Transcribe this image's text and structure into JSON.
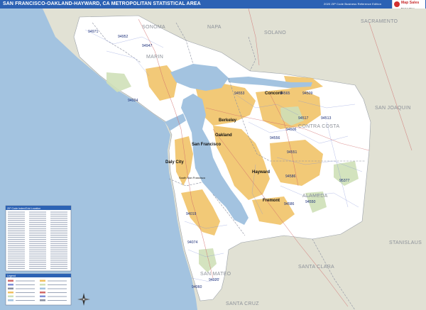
{
  "title": "SAN FRANCISCO-OAKLAND-HAYWARD, CA METROPOLITAN STATISTICAL AREA",
  "edition": "2020 ZIP Code Business Reference Edition",
  "logo": {
    "name": "Map Sales",
    "tagline": "Market Maps"
  },
  "colors": {
    "water": "#a3c3e0",
    "outside_land": "#e1e1d4",
    "metro_land": "#ffffff",
    "urban": "#f0c060",
    "park": "#cfe0b8",
    "title_bar": "#2c62b4",
    "zip_label": "#1b2f7a"
  },
  "counties": [
    {
      "id": "sonoma",
      "label": "SONOMA"
    },
    {
      "id": "napa",
      "label": "NAPA"
    },
    {
      "id": "solano",
      "label": "SOLANO"
    },
    {
      "id": "sacramento",
      "label": "SACRAMENTO"
    },
    {
      "id": "marin",
      "label": "MARIN"
    },
    {
      "id": "san-joaquin",
      "label": "SAN JOAQUIN"
    },
    {
      "id": "contra-costa",
      "label": "CONTRA COSTA"
    },
    {
      "id": "alameda",
      "label": "ALAMEDA"
    },
    {
      "id": "stanislaus",
      "label": "STANISLAUS"
    },
    {
      "id": "san-mateo",
      "label": "SAN MATEO"
    },
    {
      "id": "santa-clara",
      "label": "SANTA CLARA"
    },
    {
      "id": "santa-cruz",
      "label": "SANTA CRUZ"
    }
  ],
  "cities": [
    {
      "id": "concord",
      "label": "Concord"
    },
    {
      "id": "berkeley",
      "label": "Berkeley"
    },
    {
      "id": "oakland",
      "label": "Oakland"
    },
    {
      "id": "san-francisco",
      "label": "San Francisco"
    },
    {
      "id": "daly-city",
      "label": "Daly City"
    },
    {
      "id": "hayward",
      "label": "Hayward"
    },
    {
      "id": "fremont",
      "label": "Fremont"
    },
    {
      "id": "south-san-francisco",
      "label": "South San Francisco"
    }
  ],
  "zips": [
    "94971",
    "94952",
    "94947",
    "94924",
    "94553",
    "94565",
    "94509",
    "94517",
    "94513",
    "94506",
    "94556",
    "94551",
    "94586",
    "94550",
    "95377",
    "94586",
    "94019",
    "94074",
    "94060",
    "94020"
  ],
  "legend": {
    "title": "ZIP Code Index/Grid Location",
    "key_title": "Legend"
  }
}
